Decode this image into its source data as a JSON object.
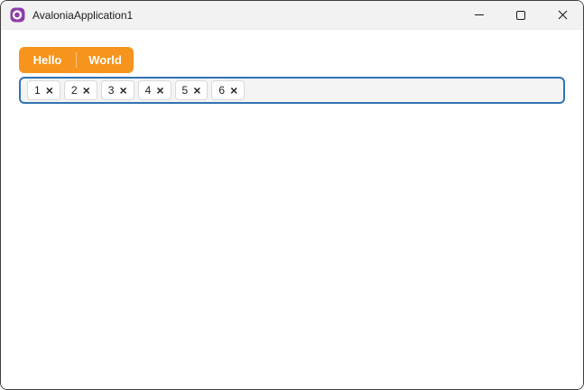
{
  "window": {
    "title": "AvaloniaApplication1",
    "controls": {
      "minimize_label": "minimize",
      "maximize_label": "maximize",
      "close_label": "close"
    }
  },
  "icons": {
    "app_logo": "avalonia-logo",
    "minimize": "horizontal-line",
    "maximize": "square-outline",
    "close": "x-cross",
    "chip_remove": "×"
  },
  "colors": {
    "tab_orange": "#F7941E",
    "chipbox_border_blue": "#3173B4",
    "titlebar_bg": "#F2F2F2",
    "chipbox_bg": "#F4F4F4",
    "logo_purple": "#8B3FA8"
  },
  "tabs": [
    {
      "label": "Hello"
    },
    {
      "label": "World"
    }
  ],
  "chip_list": {
    "chips": [
      {
        "label": "1"
      },
      {
        "label": "2"
      },
      {
        "label": "3"
      },
      {
        "label": "4"
      },
      {
        "label": "5"
      },
      {
        "label": "6"
      }
    ]
  }
}
